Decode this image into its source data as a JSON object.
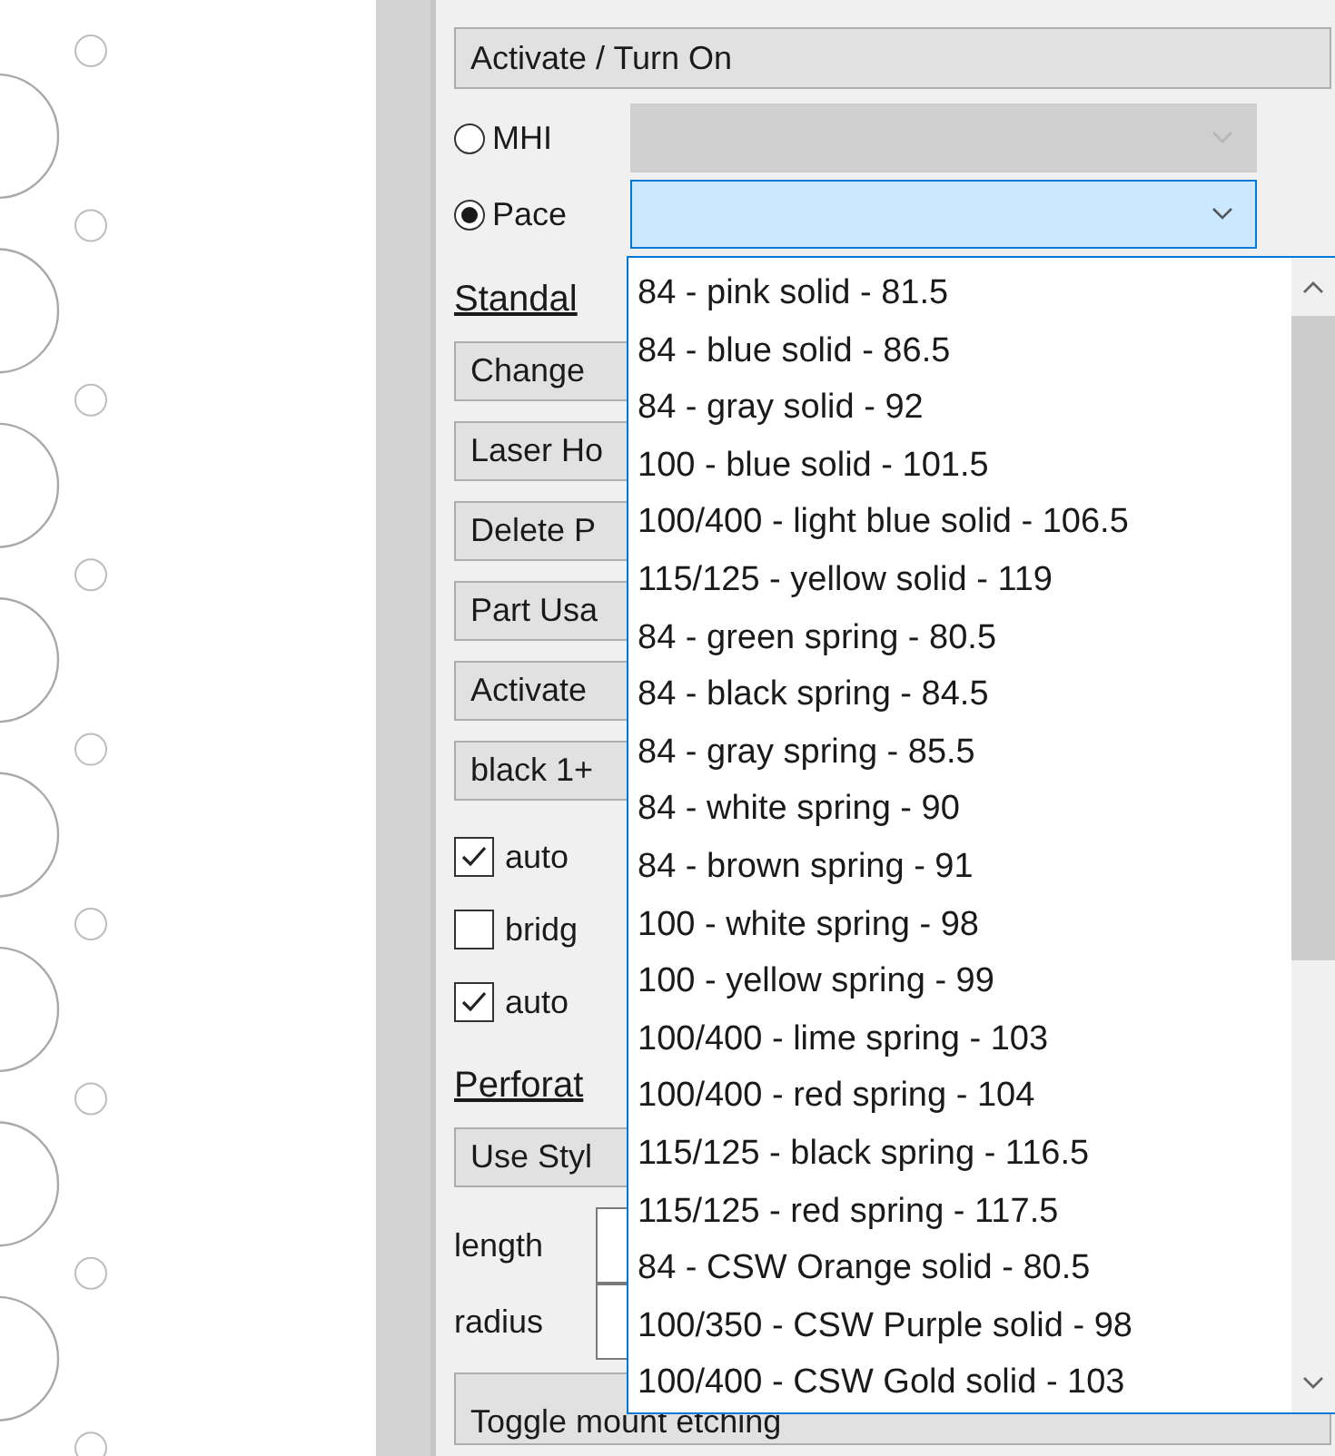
{
  "activate_button": "Activate / Turn On",
  "source_options": [
    {
      "label": "MHI",
      "selected": false,
      "combo": {
        "disabled": true,
        "open": false
      }
    },
    {
      "label": "Pace",
      "selected": true,
      "combo": {
        "disabled": false,
        "open": true,
        "items": [
          "84 - pink solid - 81.5",
          "84 - blue solid - 86.5",
          "84 - gray solid - 92",
          "100 - blue solid - 101.5",
          "100/400 - light blue solid - 106.5",
          "115/125 - yellow solid - 119",
          "84 - green spring - 80.5",
          "84 - black spring - 84.5",
          "84 - gray spring - 85.5",
          "84 - white spring - 90",
          "84 - brown spring - 91",
          "100 - white spring - 98",
          "100 - yellow spring - 99",
          "100/400 - lime spring - 103",
          "100/400 - red spring - 104",
          "115/125 - black spring - 116.5",
          "115/125 - red spring - 117.5",
          "84 - CSW Orange solid - 80.5",
          "100/350 - CSW Purple solid - 98",
          "100/400 - CSW Gold solid - 103"
        ]
      }
    }
  ],
  "controls": [
    {
      "kind": "heading",
      "label": "Standal"
    },
    {
      "kind": "button",
      "label": "Change"
    },
    {
      "kind": "button",
      "label": "Laser Ho"
    },
    {
      "kind": "button",
      "label": "Delete P"
    },
    {
      "kind": "button",
      "label": "Part Usa"
    },
    {
      "kind": "button",
      "label": "Activate"
    },
    {
      "kind": "button",
      "label": "black 1+"
    },
    {
      "kind": "checkbox",
      "label": "auto",
      "checked": true
    },
    {
      "kind": "checkbox",
      "label": "bridg",
      "checked": false
    },
    {
      "kind": "checkbox",
      "label": "auto",
      "checked": true
    },
    {
      "kind": "heading",
      "label": "Perforat"
    },
    {
      "kind": "button",
      "label": "Use Styl"
    },
    {
      "kind": "field",
      "label": "length"
    },
    {
      "kind": "field",
      "label": "radius"
    },
    {
      "kind": "button",
      "label": "Toggle mount etching"
    }
  ]
}
